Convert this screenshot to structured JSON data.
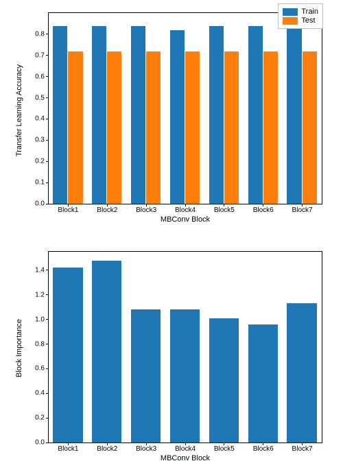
{
  "chart_data": [
    {
      "type": "bar",
      "title": "",
      "xlabel": "MBConv Block",
      "ylabel": "Transfer Learning Accuracy",
      "categories": [
        "Block1",
        "Block2",
        "Block3",
        "Block4",
        "Block5",
        "Block6",
        "Block7"
      ],
      "series": [
        {
          "name": "Train",
          "values": [
            0.84,
            0.84,
            0.84,
            0.82,
            0.84,
            0.84,
            0.84
          ]
        },
        {
          "name": "Test",
          "values": [
            0.72,
            0.72,
            0.72,
            0.72,
            0.72,
            0.72,
            0.72
          ]
        }
      ],
      "ylim": [
        0.0,
        0.9
      ],
      "yticks": [
        0.0,
        0.1,
        0.2,
        0.3,
        0.4,
        0.5,
        0.6,
        0.7,
        0.8
      ],
      "legend_position": "upper right"
    },
    {
      "type": "bar",
      "title": "",
      "xlabel": "MBConv Block",
      "ylabel": "Block Importance",
      "categories": [
        "Block1",
        "Block2",
        "Block3",
        "Block4",
        "Block5",
        "Block6",
        "Block7"
      ],
      "series": [
        {
          "name": "",
          "values": [
            1.42,
            1.48,
            1.08,
            1.08,
            1.01,
            0.96,
            1.13
          ]
        }
      ],
      "ylim": [
        0.0,
        1.55
      ],
      "yticks": [
        0.0,
        0.2,
        0.4,
        0.6,
        0.8,
        1.0,
        1.2,
        1.4
      ]
    }
  ],
  "legend": {
    "train": "Train",
    "test": "Test"
  }
}
